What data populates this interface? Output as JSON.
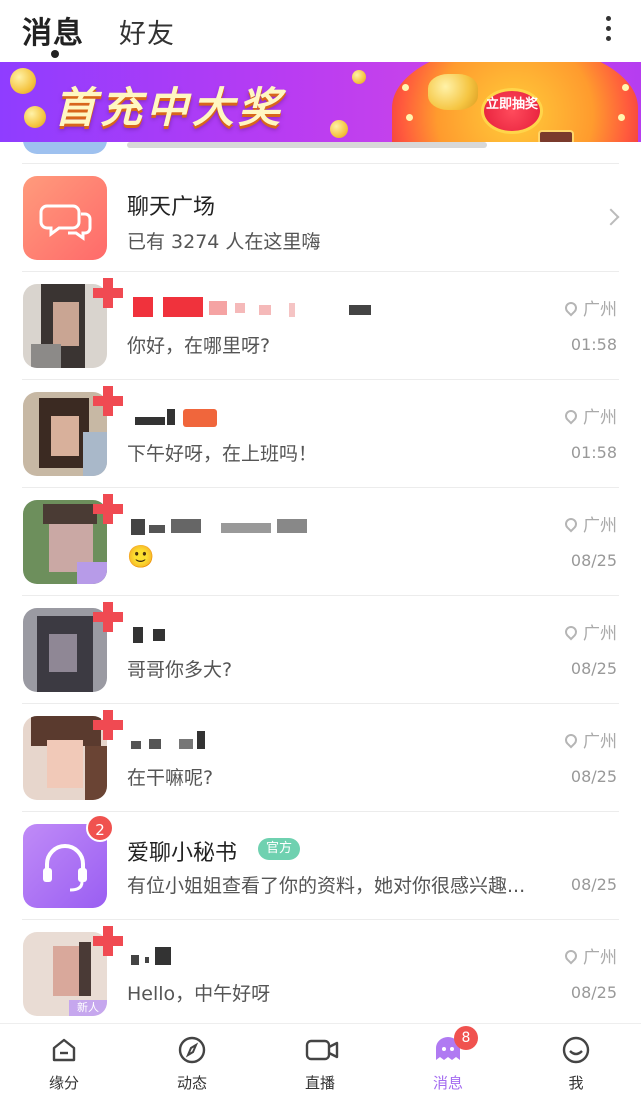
{
  "header": {
    "tabs": [
      {
        "label": "消息",
        "active": true
      },
      {
        "label": "好友",
        "active": false
      }
    ],
    "more_icon": "more-vertical-icon"
  },
  "banner": {
    "title": "首充中大奖",
    "button_label": "立即抽奖",
    "colors": {
      "bg_start": "#8f3dff",
      "bg_end": "#c944e9",
      "wheel": "#ff9b2e"
    }
  },
  "conversations": [
    {
      "type": "plaza",
      "name": "聊天广场",
      "preview": "已有 3274 人在这里嗨",
      "icon": "chat-bubbles-icon"
    },
    {
      "type": "user",
      "name_hidden": true,
      "preview": "你好，在哪里呀?",
      "location": "广州",
      "time": "01:58"
    },
    {
      "type": "user",
      "name_hidden": true,
      "preview": "下午好呀，在上班吗！",
      "location": "广州",
      "time": "01:58"
    },
    {
      "type": "user",
      "name_hidden": true,
      "preview": "🙂",
      "location": "广州",
      "time": "08/25"
    },
    {
      "type": "user",
      "name_hidden": true,
      "preview": "哥哥你多大?",
      "location": "广州",
      "time": "08/25"
    },
    {
      "type": "user",
      "name_hidden": true,
      "preview": "在干嘛呢?",
      "location": "广州",
      "time": "08/25"
    },
    {
      "type": "secretary",
      "name": "爱聊小秘书",
      "tag": "官方",
      "preview": "有位小姐姐查看了你的资料，她对你很感兴趣...",
      "time": "08/25",
      "unread": "2"
    },
    {
      "type": "user",
      "name_hidden": true,
      "preview": "Hello，中午好呀",
      "location": "广州",
      "time": "08/25",
      "avatar_tag": "新人"
    }
  ],
  "bottom_nav": [
    {
      "label": "缘分",
      "icon": "home-icon",
      "active": false
    },
    {
      "label": "动态",
      "icon": "compass-icon",
      "active": false
    },
    {
      "label": "直播",
      "icon": "video-camera-icon",
      "active": false
    },
    {
      "label": "消息",
      "icon": "message-bubble-icon",
      "active": true,
      "badge": "8"
    },
    {
      "label": "我",
      "icon": "smiley-icon",
      "active": false
    }
  ],
  "colors": {
    "accent": "#a46cf0",
    "badge": "#f0524f",
    "online": "#f04a52",
    "official_tag": "#6fd1b0"
  }
}
